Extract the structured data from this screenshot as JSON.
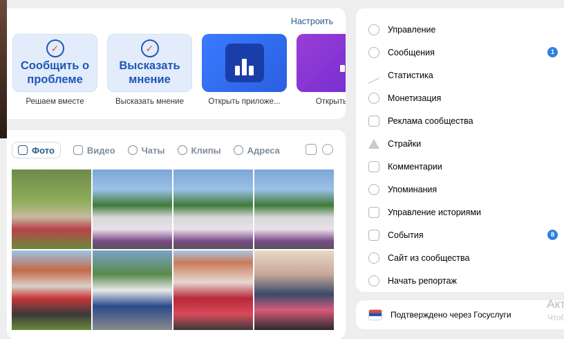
{
  "apps": {
    "configure_label": "Настроить",
    "items": [
      {
        "tile_text": "Сообщить о проблеме",
        "label": "Решаем вместе"
      },
      {
        "tile_text": "Высказать мнение",
        "label": "Высказать мнение"
      },
      {
        "tile_text": "",
        "label": "Открыть приложе..."
      },
      {
        "tile_text": "",
        "label": "Открыть при"
      }
    ]
  },
  "media": {
    "tabs": [
      {
        "label": "Фото",
        "icon": "photo-icon",
        "active": true
      },
      {
        "label": "Видео",
        "icon": "video-icon"
      },
      {
        "label": "Чаты",
        "icon": "chats-icon"
      },
      {
        "label": "Клипы",
        "icon": "clips-icon"
      },
      {
        "label": "Адреса",
        "icon": "location-icon"
      }
    ]
  },
  "menu": {
    "items": [
      {
        "label": "Управление",
        "icon": "gear-icon"
      },
      {
        "label": "Сообщения",
        "icon": "message-icon",
        "badge": "1"
      },
      {
        "label": "Статистика",
        "icon": "statistics-icon"
      },
      {
        "label": "Монетизация",
        "icon": "monetization-icon"
      },
      {
        "label": "Реклама сообщества",
        "icon": "megaphone-icon"
      },
      {
        "label": "Страйки",
        "icon": "warning-icon"
      },
      {
        "label": "Комментарии",
        "icon": "comment-icon"
      },
      {
        "label": "Упоминания",
        "icon": "at-icon"
      },
      {
        "label": "Управление историями",
        "icon": "stories-icon"
      },
      {
        "label": "События",
        "icon": "calendar-icon",
        "badge": "8"
      },
      {
        "label": "Сайт из сообщества",
        "icon": "globe-icon"
      },
      {
        "label": "Начать репортаж",
        "icon": "broadcast-icon"
      }
    ]
  },
  "gos": {
    "label": "Подтверждено через Госуслуги"
  },
  "watermark": {
    "title": "Акт",
    "subtitle": "Чтоб"
  },
  "colors": {
    "accent": "#2d81e0",
    "link": "#2a5885",
    "background": "#edeef0"
  }
}
